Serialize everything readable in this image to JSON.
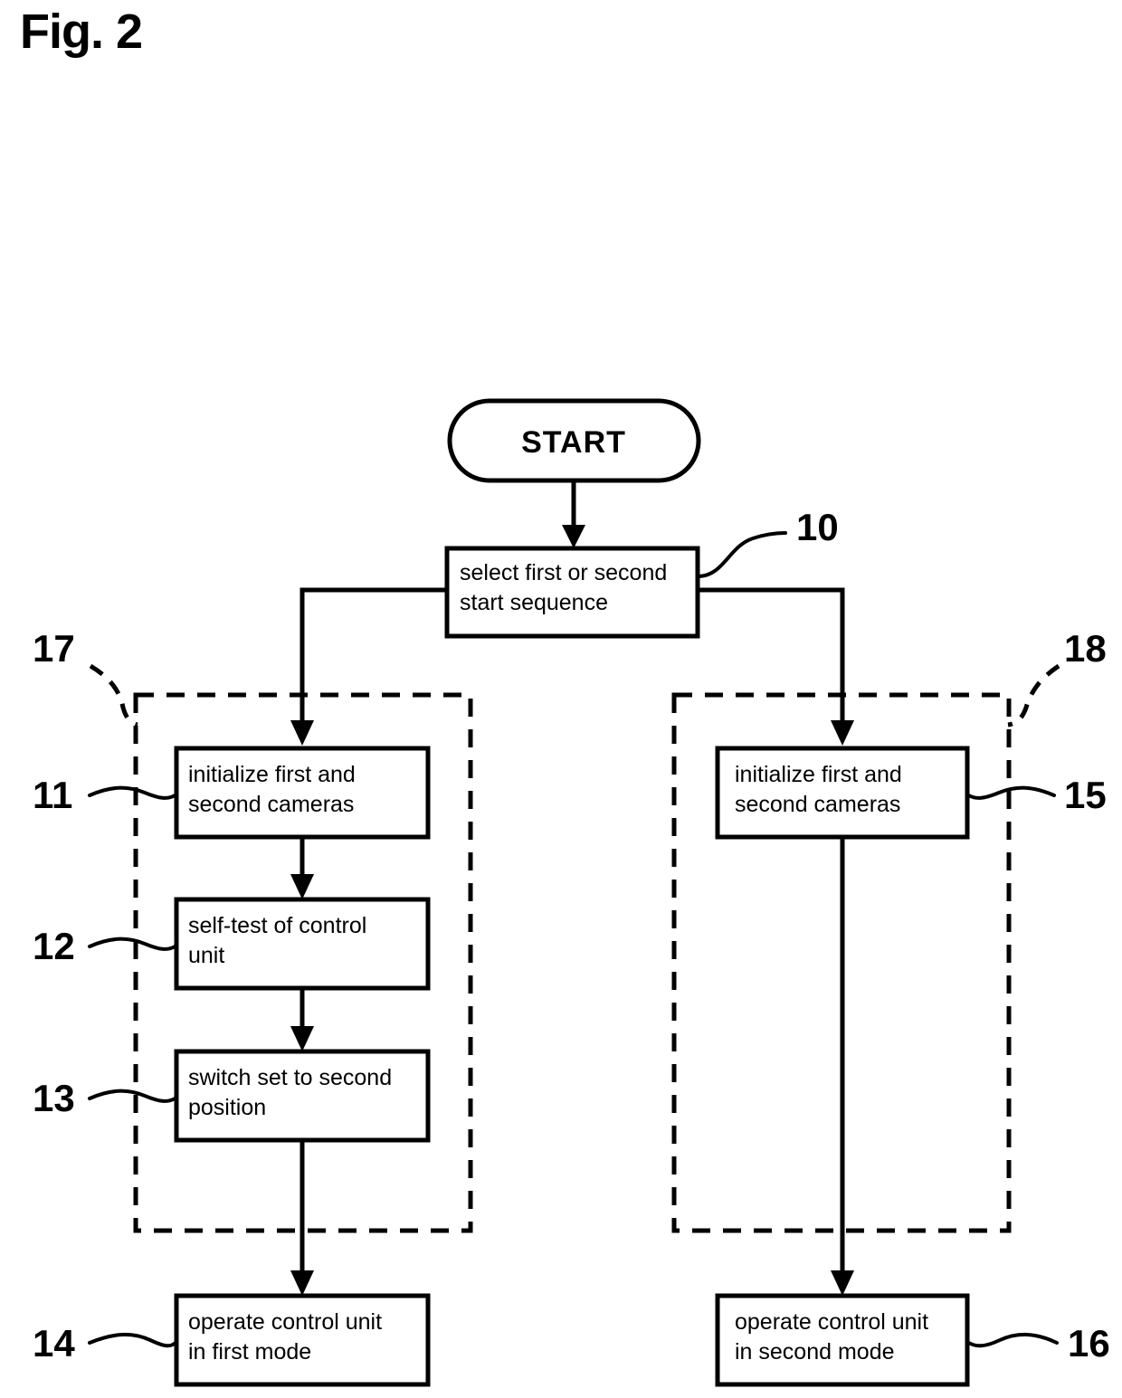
{
  "figure": {
    "label": "Fig. 2",
    "kind": "patent-flowchart"
  },
  "nodes": {
    "start": {
      "label": "START",
      "shape": "stadium"
    },
    "select": {
      "ref": "10",
      "line1": "select first or second",
      "line2": "start sequence"
    },
    "init_left": {
      "ref": "11",
      "line1": "initialize first and",
      "line2": "second cameras"
    },
    "selftest": {
      "ref": "12",
      "line1": "self-test of control",
      "line2": "unit"
    },
    "switch": {
      "ref": "13",
      "line1": "switch set to second",
      "line2": "position"
    },
    "operate_first": {
      "ref": "14",
      "line1": "operate control unit",
      "line2": "in first mode"
    },
    "init_right": {
      "ref": "15",
      "line1": "initialize first and",
      "line2": "second cameras"
    },
    "operate_second": {
      "ref": "16",
      "line1": "operate control unit",
      "line2": "in second mode"
    }
  },
  "groups": {
    "first_sequence": {
      "ref": "17"
    },
    "second_sequence": {
      "ref": "18"
    }
  },
  "colors": {
    "ink": "#000000",
    "paper": "#ffffff"
  }
}
